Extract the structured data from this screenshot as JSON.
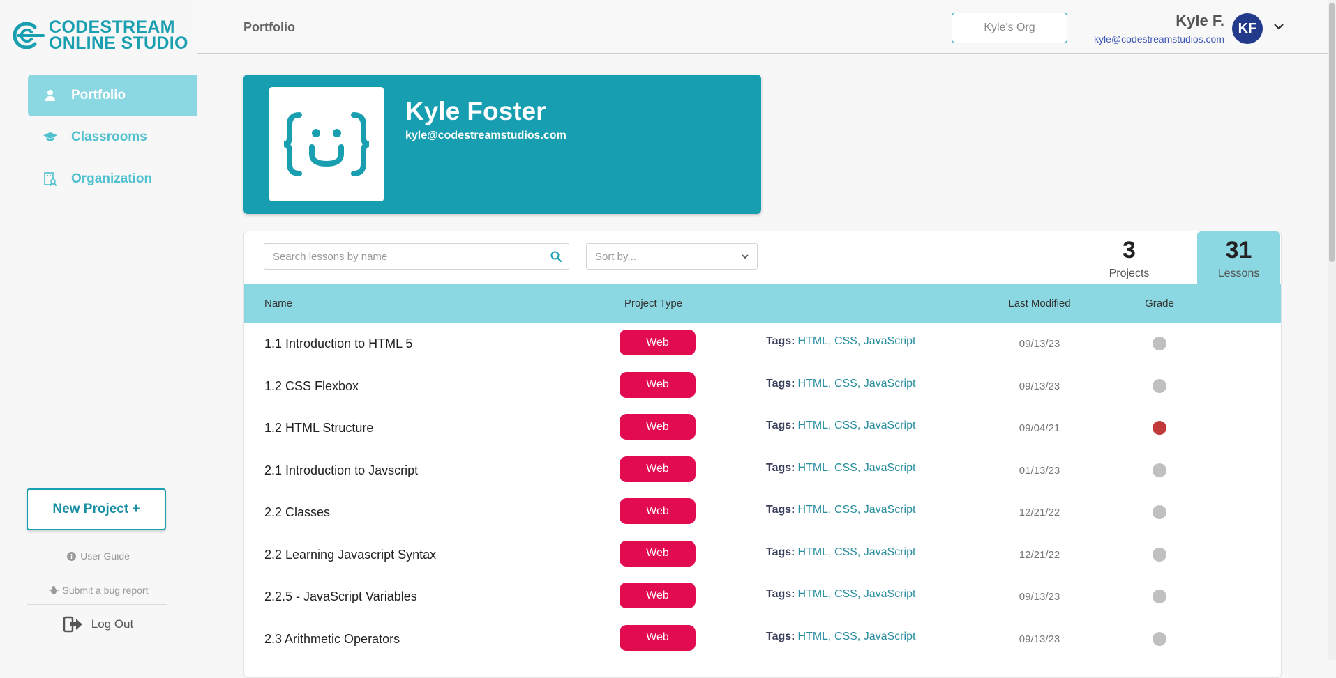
{
  "brand": {
    "line1": "CODESTREAM",
    "line2": "ONLINE STUDIO",
    "color": "#1a9fb1"
  },
  "sidebar": {
    "items": [
      {
        "label": "Portfolio",
        "icon": "user-icon",
        "active": true
      },
      {
        "label": "Classrooms",
        "icon": "graduation-cap-icon",
        "active": false
      },
      {
        "label": "Organization",
        "icon": "organization-icon",
        "active": false
      }
    ],
    "new_project": "New Project +",
    "user_guide": "User Guide",
    "bug_report": "Submit a bug report",
    "logout": "Log Out"
  },
  "topbar": {
    "title": "Portfolio",
    "org": "Kyle's Org",
    "user_name": "Kyle F.",
    "user_email": "kyle@codestreamstudios.com",
    "avatar_initials": "KF",
    "avatar_color": "#233a8b"
  },
  "profile": {
    "name": "Kyle Foster",
    "email": "kyle@codestreamstudios.com",
    "card_color": "#179eb1"
  },
  "lessons": {
    "search_placeholder": "Search lessons by name",
    "sort_placeholder": "Sort by...",
    "projects_count": "3",
    "projects_label": "Projects",
    "lessons_count": "31",
    "lessons_label": "Lessons",
    "columns": {
      "name": "Name",
      "type": "Project Type",
      "modified": "Last Modified",
      "grade": "Grade"
    },
    "tags_label": "Tags:",
    "rows": [
      {
        "name": "1.1 Introduction to HTML 5",
        "type": "Web",
        "tags": [
          "HTML",
          "CSS",
          "JavaScript"
        ],
        "date": "09/13/23",
        "grade": "none"
      },
      {
        "name": "1.2 CSS Flexbox",
        "type": "Web",
        "tags": [
          "HTML",
          "CSS",
          "JavaScript"
        ],
        "date": "09/13/23",
        "grade": "none"
      },
      {
        "name": "1.2 HTML Structure",
        "type": "Web",
        "tags": [
          "HTML",
          "CSS",
          "JavaScript"
        ],
        "date": "09/04/21",
        "grade": "red"
      },
      {
        "name": "2.1 Introduction to Javscript",
        "type": "Web",
        "tags": [
          "HTML",
          "CSS",
          "JavaScript"
        ],
        "date": "01/13/23",
        "grade": "none"
      },
      {
        "name": "2.2 Classes",
        "type": "Web",
        "tags": [
          "HTML",
          "CSS",
          "JavaScript"
        ],
        "date": "12/21/22",
        "grade": "none"
      },
      {
        "name": "2.2 Learning Javascript Syntax",
        "type": "Web",
        "tags": [
          "HTML",
          "CSS",
          "JavaScript"
        ],
        "date": "12/21/22",
        "grade": "none"
      },
      {
        "name": "2.2.5 - JavaScript Variables",
        "type": "Web",
        "tags": [
          "HTML",
          "CSS",
          "JavaScript"
        ],
        "date": "09/13/23",
        "grade": "none"
      },
      {
        "name": "2.3 Arithmetic Operators",
        "type": "Web",
        "tags": [
          "HTML",
          "CSS",
          "JavaScript"
        ],
        "date": "09/13/23",
        "grade": "none"
      }
    ]
  },
  "colors": {
    "accent": "#1a9fb1",
    "header_row": "#8bd7e2",
    "badge": "#e30b4f",
    "grade_empty": "#c0c0c0",
    "grade_red": "#c0393b"
  }
}
